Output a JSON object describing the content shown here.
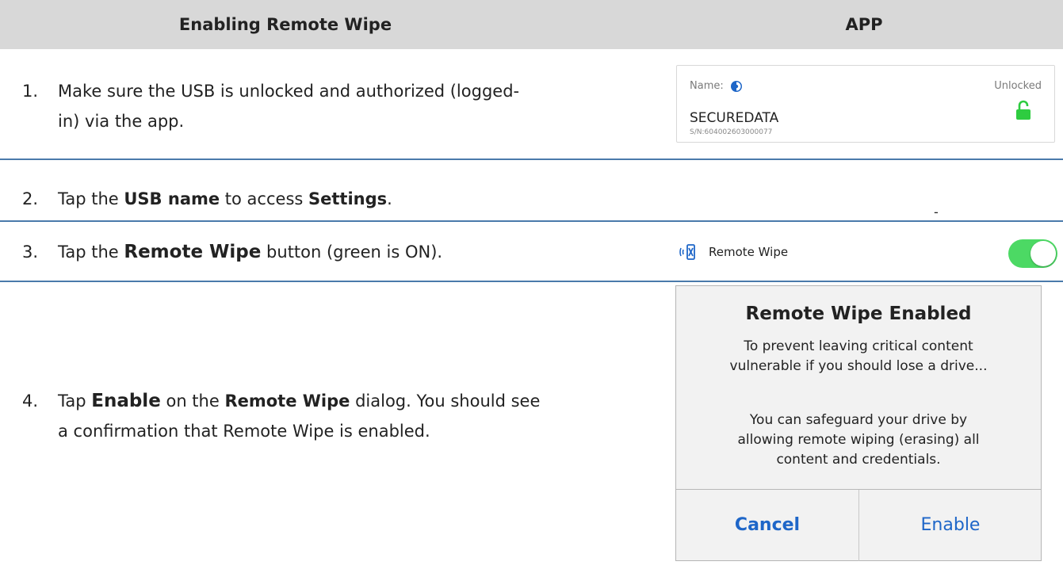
{
  "header": {
    "left_title": "Enabling Remote Wipe",
    "right_title": "APP"
  },
  "steps": [
    {
      "number": "1.",
      "line1": "Make sure the USB is unlocked and authorized (logged-",
      "line2": "in) via the app."
    },
    {
      "number": "2.",
      "pre": "Tap the ",
      "bold1": "USB name",
      "mid": " to access ",
      "bold2": "Settings",
      "post": "."
    },
    {
      "number": "3.",
      "pre": "Tap the ",
      "bold1": "Remote Wipe",
      "post": " button (green is ON)."
    },
    {
      "number": "4.",
      "pre": "Tap ",
      "bold1": "Enable",
      "mid": " on the ",
      "bold2": "Remote Wipe",
      "post": " dialog. You should see",
      "line2": "a confirmation that Remote Wipe is enabled."
    }
  ],
  "usb_card": {
    "name_label": "Name:",
    "status": "Unlocked",
    "device_name": "SECUREDATA",
    "serial": "S/N:604002603000077",
    "name_icon": "info-toggle-icon",
    "status_icon": "unlocked-padlock-icon",
    "status_color": "#2ecc40"
  },
  "step2_panel": {
    "placeholder": "-"
  },
  "remote_wipe_row": {
    "icon": "remote-wipe-icon",
    "label": "Remote Wipe",
    "toggle_on": true,
    "toggle_color": "#4cd964"
  },
  "dialog": {
    "title": "Remote Wipe Enabled",
    "body_line1": "To prevent leaving critical content",
    "body_line2": "vulnerable if you should lose a drive...",
    "body_line3": "You can safeguard your drive by",
    "body_line4": "allowing remote wiping (erasing) all",
    "body_line5": "content and credentials.",
    "cancel_label": "Cancel",
    "enable_label": "Enable",
    "button_color": "#1e66c8"
  }
}
